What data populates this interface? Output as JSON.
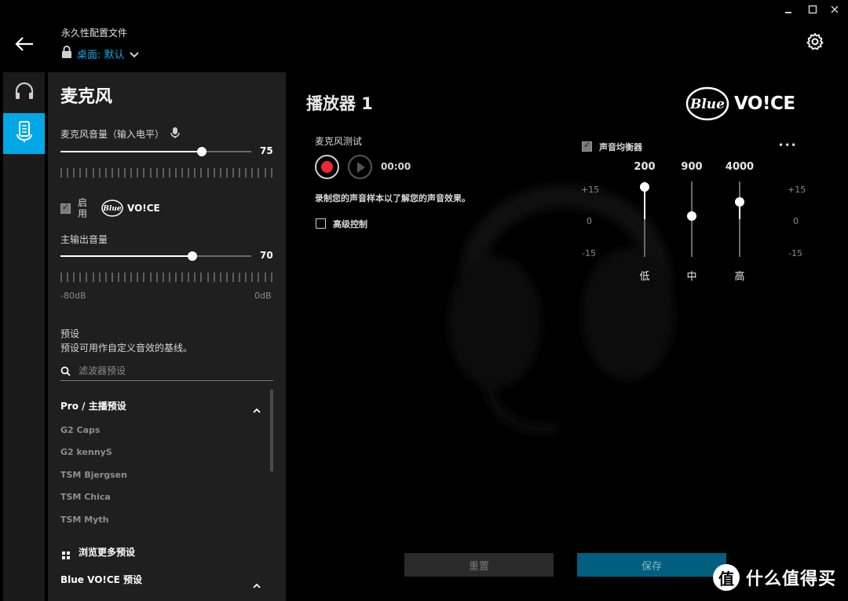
{
  "window": {
    "minimize": "▪",
    "maximize": "□",
    "close": "✕"
  },
  "header": {
    "profile_title": "永久性配置文件",
    "profile_name": "桌面: 默认"
  },
  "panel": {
    "title": "麦克风",
    "mic_volume_label": "麦克风音量（输入电平）",
    "mic_volume_value": "75",
    "mic_volume_level": 75,
    "enable_label": "启用",
    "blue_voice_logo": "Blue VO!CE",
    "main_output_label": "主输出音量",
    "main_output_value": "70",
    "main_output_level": 70,
    "range_min": "-80dB",
    "range_max": "0dB",
    "presets_title": "预设",
    "presets_desc": "预设可用作自定义音效的基线。",
    "filter_placeholder": "滤波器预设",
    "group1_label": "Pro / 主播预设",
    "presets": [
      "G2 Caps",
      "G2 kennyS",
      "TSM Bjergsen",
      "TSM Chica",
      "TSM Myth"
    ],
    "browse_more": "浏览更多预设",
    "group2_label": "Blue VO!CE 预设"
  },
  "main": {
    "title": "播放器 1",
    "mic_test_label": "麦克风测试",
    "time": "00:00",
    "record_hint": "录制您的声音样本以了解您的声音效果。",
    "advanced_label": "高级控制",
    "eq_label": "声音均衡器",
    "more": "•••",
    "eq_scale": {
      "top": "+15",
      "mid": "0",
      "bottom": "-15"
    },
    "eq_bands": [
      {
        "freq": "200",
        "name": "低",
        "gain": 15
      },
      {
        "freq": "900",
        "name": "中",
        "gain": 0
      },
      {
        "freq": "4000",
        "name": "高",
        "gain": 6
      }
    ],
    "reset_label": "重置",
    "save_label": "保存"
  },
  "brand_logo": "Blue VO!CE",
  "watermark": {
    "symbol": "值",
    "text": "什么值得买"
  }
}
